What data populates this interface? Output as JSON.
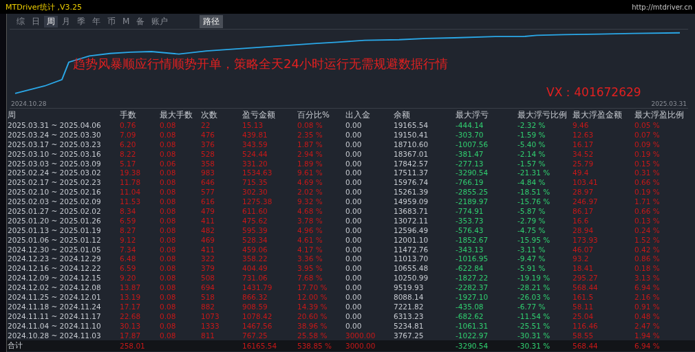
{
  "window": {
    "title": "MTDriver统计 ,V3.25",
    "url": "http://mtdriver.cn"
  },
  "tabs": [
    {
      "label": "综",
      "selected": false
    },
    {
      "label": "日",
      "selected": false
    },
    {
      "label": "周",
      "selected": true
    },
    {
      "label": "月",
      "selected": false
    },
    {
      "label": "季",
      "selected": false
    },
    {
      "label": "年",
      "selected": false
    },
    {
      "label": "币",
      "selected": false
    },
    {
      "label": "M",
      "selected": false
    },
    {
      "label": "备",
      "selected": false
    },
    {
      "label": "账户",
      "selected": false
    }
  ],
  "path_button": "路径",
  "chart": {
    "start_date": "2024.10.28",
    "end_date": "2025.03.31",
    "slogan": "趋势风暴顺应行情顺势开单，策略全天24小时运行无需规避数据行情",
    "contact": "VX：401672629"
  },
  "table": {
    "columns": [
      {
        "label": "周",
        "kind": "plain"
      },
      {
        "label": "手数",
        "kind": "profit"
      },
      {
        "label": "最大手数",
        "kind": "profit"
      },
      {
        "label": "次数",
        "kind": "profit"
      },
      {
        "label": "盈亏金额",
        "kind": "profit"
      },
      {
        "label": "百分比%",
        "kind": "profit"
      },
      {
        "label": "出入金",
        "kind": "deposit"
      },
      {
        "label": "余额",
        "kind": "plain"
      },
      {
        "label": "最大浮亏",
        "kind": "loss"
      },
      {
        "label": "最大浮亏比例",
        "kind": "loss"
      },
      {
        "label": "最大浮盈金额",
        "kind": "profit"
      },
      {
        "label": "最大浮盈比例",
        "kind": "profit"
      }
    ],
    "rows": [
      {
        "deposit_made": false,
        "cells": [
          "2025.03.31 ~ 2025.04.06",
          "0.76",
          "0.08",
          "22",
          "15.13",
          "0.08 %",
          "0.00",
          "19165.54",
          "-444.14",
          "-2.32 %",
          "9.46",
          "0.05 %"
        ]
      },
      {
        "deposit_made": false,
        "cells": [
          "2025.03.24 ~ 2025.03.30",
          "7.09",
          "0.08",
          "476",
          "439.81",
          "2.35 %",
          "0.00",
          "19150.41",
          "-303.70",
          "-1.59 %",
          "12.63",
          "0.07 %"
        ]
      },
      {
        "deposit_made": false,
        "cells": [
          "2025.03.17 ~ 2025.03.23",
          "6.20",
          "0.08",
          "376",
          "343.59",
          "1.87 %",
          "0.00",
          "18710.60",
          "-1007.56",
          "-5.40 %",
          "16.17",
          "0.09 %"
        ]
      },
      {
        "deposit_made": false,
        "cells": [
          "2025.03.10 ~ 2025.03.16",
          "8.22",
          "0.08",
          "528",
          "524.44",
          "2.94 %",
          "0.00",
          "18367.01",
          "-381.47",
          "-2.14 %",
          "34.52",
          "0.19 %"
        ]
      },
      {
        "deposit_made": false,
        "cells": [
          "2025.03.03 ~ 2025.03.09",
          "5.17",
          "0.06",
          "358",
          "331.20",
          "1.89 %",
          "0.00",
          "17842.57",
          "-277.13",
          "-1.57 %",
          "25.79",
          "0.15 %"
        ]
      },
      {
        "deposit_made": false,
        "cells": [
          "2025.02.24 ~ 2025.03.02",
          "19.38",
          "0.08",
          "983",
          "1534.63",
          "9.61 %",
          "0.00",
          "17511.37",
          "-3290.54",
          "-21.31 %",
          "49.4",
          "0.31 %"
        ]
      },
      {
        "deposit_made": false,
        "cells": [
          "2025.02.17 ~ 2025.02.23",
          "11.78",
          "0.08",
          "646",
          "715.35",
          "4.69 %",
          "0.00",
          "15976.74",
          "-766.19",
          "-4.84 %",
          "103.41",
          "0.66 %"
        ]
      },
      {
        "deposit_made": false,
        "cells": [
          "2025.02.10 ~ 2025.02.16",
          "11.04",
          "0.08",
          "577",
          "302.30",
          "2.02 %",
          "0.00",
          "15261.39",
          "-2855.25",
          "-18.51 %",
          "28.97",
          "0.19 %"
        ]
      },
      {
        "deposit_made": false,
        "cells": [
          "2025.02.03 ~ 2025.02.09",
          "11.53",
          "0.08",
          "616",
          "1275.38",
          "9.32 %",
          "0.00",
          "14959.09",
          "-2189.97",
          "-15.76 %",
          "246.97",
          "1.71 %"
        ]
      },
      {
        "deposit_made": false,
        "cells": [
          "2025.01.27 ~ 2025.02.02",
          "8.34",
          "0.08",
          "479",
          "611.60",
          "4.68 %",
          "0.00",
          "13683.71",
          "-774.91",
          "-5.87 %",
          "86.17",
          "0.66 %"
        ]
      },
      {
        "deposit_made": false,
        "cells": [
          "2025.01.20 ~ 2025.01.26",
          "6.59",
          "0.08",
          "411",
          "475.62",
          "3.78 %",
          "0.00",
          "13072.11",
          "-353.73",
          "-2.79 %",
          "16.6",
          "0.13 %"
        ]
      },
      {
        "deposit_made": false,
        "cells": [
          "2025.01.13 ~ 2025.01.19",
          "8.27",
          "0.08",
          "482",
          "595.39",
          "4.96 %",
          "0.00",
          "12596.49",
          "-576.43",
          "-4.75 %",
          "28.94",
          "0.24 %"
        ]
      },
      {
        "deposit_made": false,
        "cells": [
          "2025.01.06 ~ 2025.01.12",
          "9.12",
          "0.08",
          "469",
          "528.34",
          "4.61 %",
          "0.00",
          "12001.10",
          "-1852.67",
          "-15.95 %",
          "173.93",
          "1.52 %"
        ]
      },
      {
        "deposit_made": false,
        "cells": [
          "2024.12.30 ~ 2025.01.05",
          "7.34",
          "0.08",
          "411",
          "459.06",
          "4.17 %",
          "0.00",
          "11472.76",
          "-343.13",
          "-3.11 %",
          "46.07",
          "0.42 %"
        ]
      },
      {
        "deposit_made": false,
        "cells": [
          "2024.12.23 ~ 2024.12.29",
          "6.48",
          "0.08",
          "322",
          "358.22",
          "3.36 %",
          "0.00",
          "11013.70",
          "-1016.95",
          "-9.47 %",
          "93.2",
          "0.86 %"
        ]
      },
      {
        "deposit_made": false,
        "cells": [
          "2024.12.16 ~ 2024.12.22",
          "6.59",
          "0.08",
          "379",
          "404.49",
          "3.95 %",
          "0.00",
          "10655.48",
          "-622.84",
          "-5.91 %",
          "18.41",
          "0.18 %"
        ]
      },
      {
        "deposit_made": false,
        "cells": [
          "2024.12.09 ~ 2024.12.15",
          "9.20",
          "0.08",
          "508",
          "731.06",
          "7.68 %",
          "0.00",
          "10250.99",
          "-1827.22",
          "-19.19 %",
          "295.27",
          "3.13 %"
        ]
      },
      {
        "deposit_made": false,
        "cells": [
          "2024.12.02 ~ 2024.12.08",
          "13.87",
          "0.08",
          "694",
          "1431.79",
          "17.70 %",
          "0.00",
          "9519.93",
          "-2282.37",
          "-28.21 %",
          "568.44",
          "6.94 %"
        ]
      },
      {
        "deposit_made": false,
        "cells": [
          "2024.11.25 ~ 2024.12.01",
          "13.19",
          "0.08",
          "518",
          "866.32",
          "12.00 %",
          "0.00",
          "8088.14",
          "-1927.10",
          "-26.03 %",
          "161.5",
          "2.16 %"
        ]
      },
      {
        "deposit_made": false,
        "cells": [
          "2024.11.18 ~ 2024.11.24",
          "17.17",
          "0.08",
          "882",
          "908.59",
          "14.39 %",
          "0.00",
          "7221.82",
          "-435.08",
          "-6.77 %",
          "58.11",
          "0.91 %"
        ]
      },
      {
        "deposit_made": false,
        "cells": [
          "2024.11.11 ~ 2024.11.17",
          "22.68",
          "0.08",
          "1073",
          "1078.42",
          "20.60 %",
          "0.00",
          "6313.23",
          "-682.62",
          "-11.54 %",
          "25.04",
          "0.48 %"
        ]
      },
      {
        "deposit_made": false,
        "cells": [
          "2024.11.04 ~ 2024.11.10",
          "30.13",
          "0.08",
          "1333",
          "1467.56",
          "38.96 %",
          "0.00",
          "5234.81",
          "-1061.31",
          "-25.51 %",
          "116.46",
          "2.47 %"
        ]
      },
      {
        "deposit_made": true,
        "cells": [
          "2024.10.28 ~ 2024.11.03",
          "17.87",
          "0.08",
          "811",
          "767.25",
          "25.58 %",
          "3000.00",
          "3767.25",
          "-1022.97",
          "-30.31 %",
          "58.55",
          "1.94 %"
        ]
      }
    ],
    "total": {
      "deposit_made": true,
      "cells": [
        "合计",
        "258.01",
        null,
        null,
        "16165.54",
        "538.85 %",
        "3000.00",
        null,
        "-3290.54",
        "-30.31 %",
        "568.44",
        "6.94 %"
      ]
    }
  }
}
